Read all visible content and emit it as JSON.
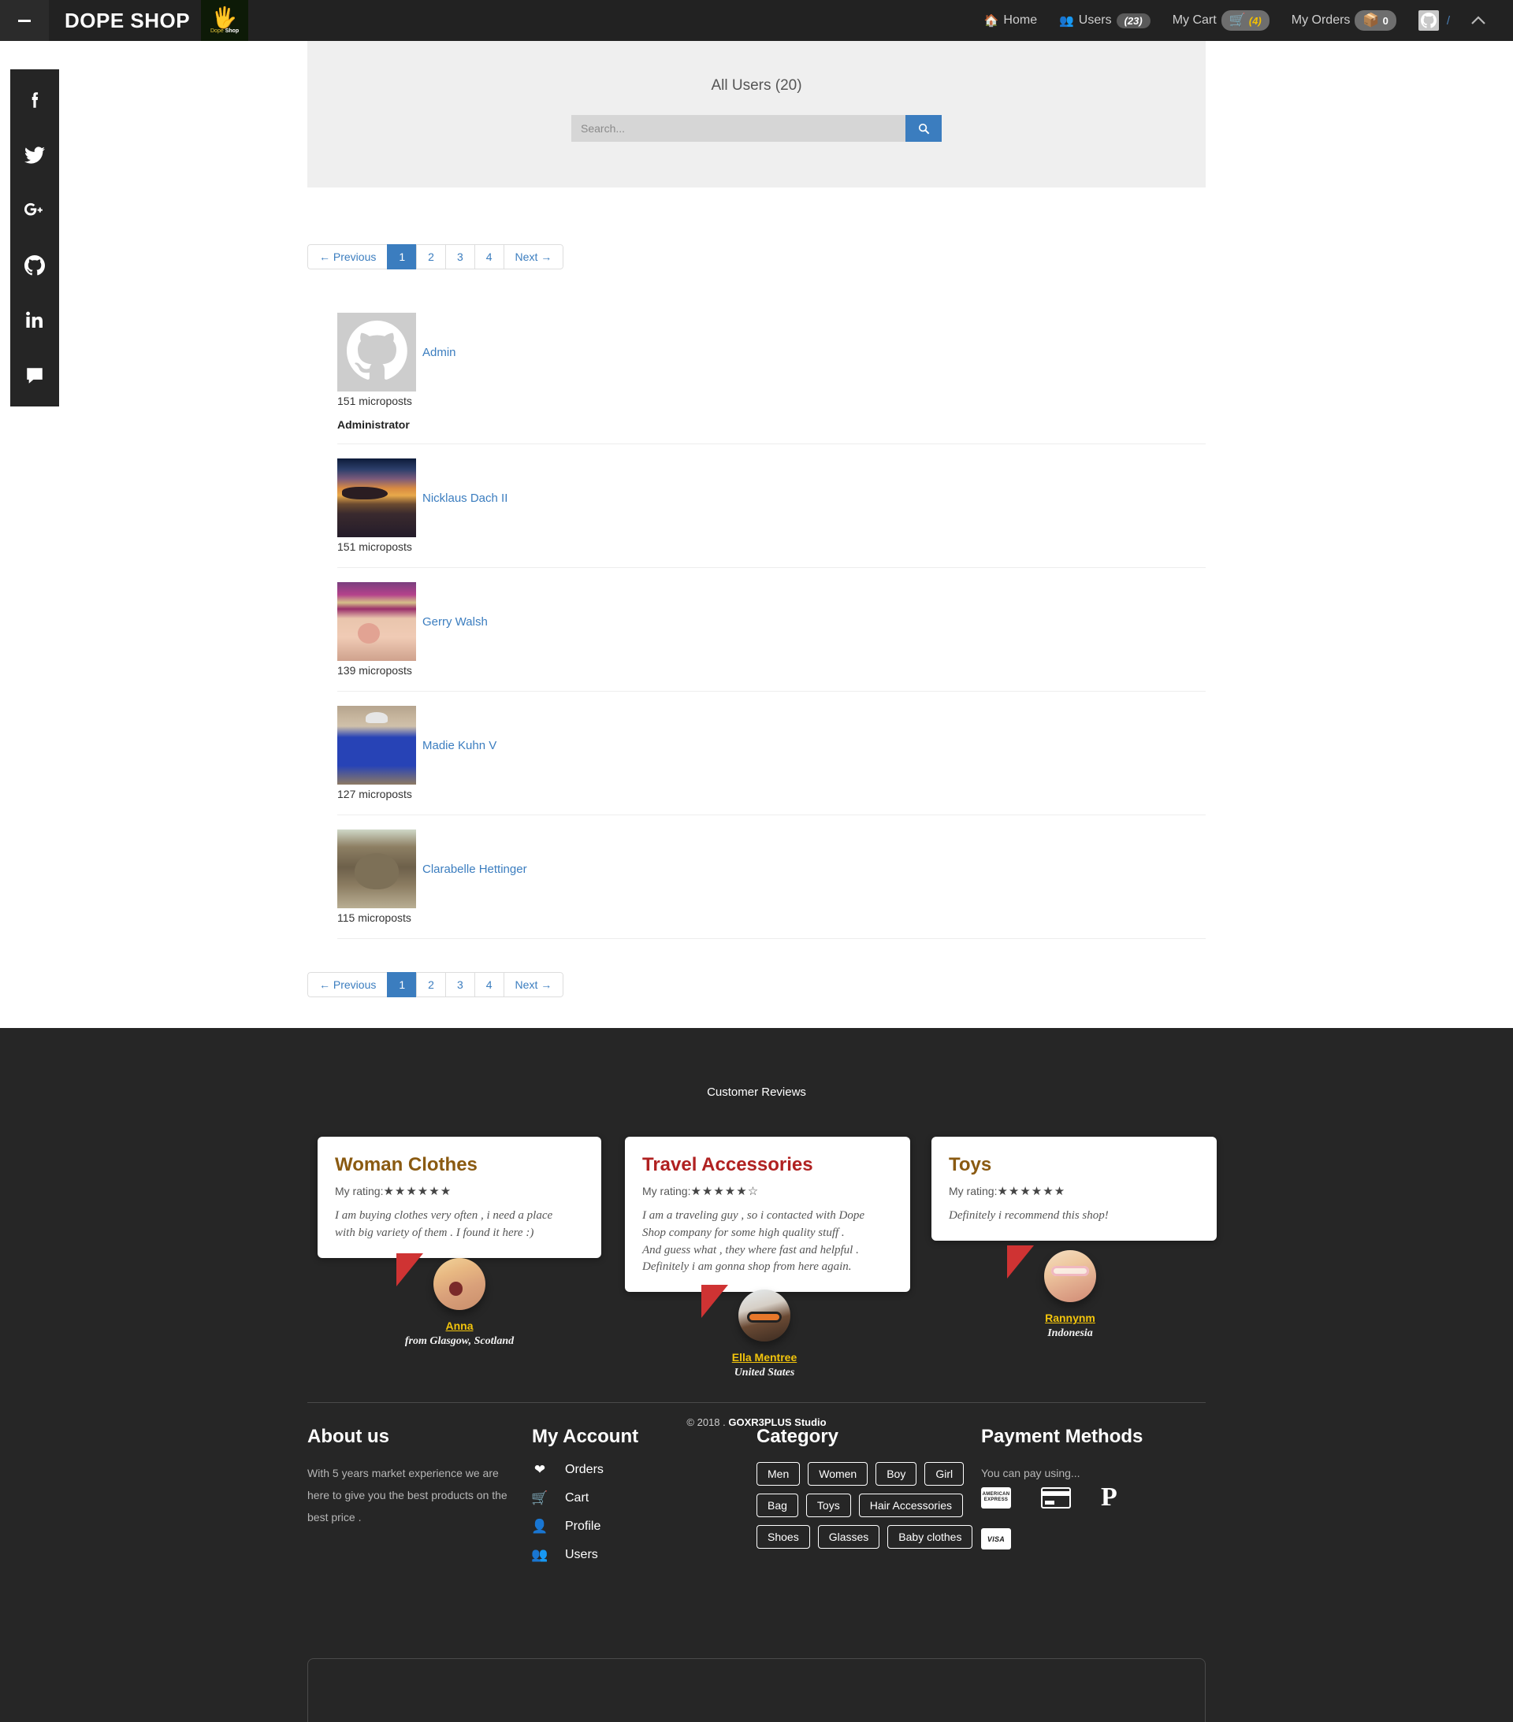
{
  "navbar": {
    "toggle_name": "sidebar-toggle",
    "brand": "DOPE SHOP",
    "logo_text_1": "Dope ",
    "logo_text_2": "Shop",
    "items": [
      {
        "label": "Home",
        "icon": "home-icon"
      },
      {
        "label": "Users",
        "icon": "users-icon",
        "badge": "(23)"
      },
      {
        "label": "My Cart",
        "icon": "cart-icon",
        "badge": "(4)"
      },
      {
        "label": "My Orders",
        "icon": "basket-icon",
        "badge": "0"
      }
    ],
    "account_slash": "/",
    "collapse_icon": "chevron-up-icon"
  },
  "social": [
    {
      "name": "facebook-icon",
      "label": "Facebook"
    },
    {
      "name": "twitter-icon",
      "label": "Twitter"
    },
    {
      "name": "google-plus-icon",
      "label": "Google Plus"
    },
    {
      "name": "github-icon",
      "label": "GitHub"
    },
    {
      "name": "linkedin-icon",
      "label": "LinkedIn"
    },
    {
      "name": "comments-icon",
      "label": "Comments"
    }
  ],
  "hero": {
    "title": "All Users (20)",
    "search_placeholder": "Search...",
    "search_value": "",
    "search_button_icon": "search-icon"
  },
  "pagination": {
    "previous": "← Previous",
    "pages": [
      "1",
      "2",
      "3",
      "4"
    ],
    "active": "1",
    "next": "Next →"
  },
  "users": [
    {
      "name": "Admin",
      "microposts": "151 microposts",
      "role": "Administrator",
      "avatar": "github-octocat-avatar"
    },
    {
      "name": "Nicklaus Dach II",
      "microposts": "151 microposts",
      "role": "",
      "avatar": "sunset-photo-avatar"
    },
    {
      "name": "Gerry Walsh",
      "microposts": "139 microposts",
      "role": "",
      "avatar": "baby-photo-avatar"
    },
    {
      "name": "Madie Kuhn V",
      "microposts": "127 microposts",
      "role": "",
      "avatar": "man-photo-avatar"
    },
    {
      "name": "Clarabelle Hettinger",
      "microposts": "115 microposts",
      "role": "",
      "avatar": "cat-photo-avatar"
    }
  ],
  "footer": {
    "reviews_heading": "Customer Reviews",
    "rating_label": "My rating:",
    "reviews": [
      {
        "title": "Woman Clothes",
        "title_color": "#8a5a11",
        "stars": "★★★★★★",
        "text": "I am buying clothes very often , i need a place\nwith big variety of them . I found it here :)",
        "reviewer": "Anna",
        "location": "from Glasgow, Scotland"
      },
      {
        "title": "Travel Accessories",
        "title_color": "#b02121",
        "stars": "★★★★★☆",
        "text": "I am a traveling guy , so i contacted with Dope\nShop company for some high quality stuff .\nAnd guess what , they where fast and helpful .\nDefinitely i am gonna shop from here again.",
        "reviewer": "Ella Mentree",
        "location": "United States"
      },
      {
        "title": "Toys",
        "title_color": "#8a5a11",
        "stars": "★★★★★★",
        "text": "Definitely i recommend this shop!",
        "reviewer": "Rannynm",
        "location": "Indonesia"
      }
    ],
    "about": {
      "heading": "About us",
      "text": "With 5 years market experience we are here to give you the best products on the best price ."
    },
    "account": {
      "heading": "My Account",
      "items": [
        {
          "label": "Orders",
          "icon": "heart-icon"
        },
        {
          "label": "Cart",
          "icon": "cart-icon"
        },
        {
          "label": "Profile",
          "icon": "user-icon"
        },
        {
          "label": "Users",
          "icon": "users-icon"
        }
      ]
    },
    "category": {
      "heading": "Category",
      "chips": [
        "Men",
        "Women",
        "Boy",
        "Girl",
        "Bag",
        "Toys",
        "Hair Accessories",
        "Shoes",
        "Glasses",
        "Baby clothes"
      ]
    },
    "payment": {
      "heading": "Payment Methods",
      "note": "You can pay using...",
      "methods": [
        {
          "name": "amex-icon",
          "label": "AMERICAN EXPRESS"
        },
        {
          "name": "credit-card-icon",
          "label": ""
        },
        {
          "name": "paypal-icon",
          "label": "P"
        },
        {
          "name": "visa-icon",
          "label": "VISA"
        }
      ]
    },
    "copyright_prefix": "© 2018 . ",
    "copyright_studio": "GOXR3PLUS Studio"
  },
  "colors": {
    "accent_blue": "#3b7dbf",
    "nav_bg": "#222222",
    "footer_bg": "#262626",
    "yellow": "#f2c40c",
    "red_pointer": "#cf3333"
  }
}
